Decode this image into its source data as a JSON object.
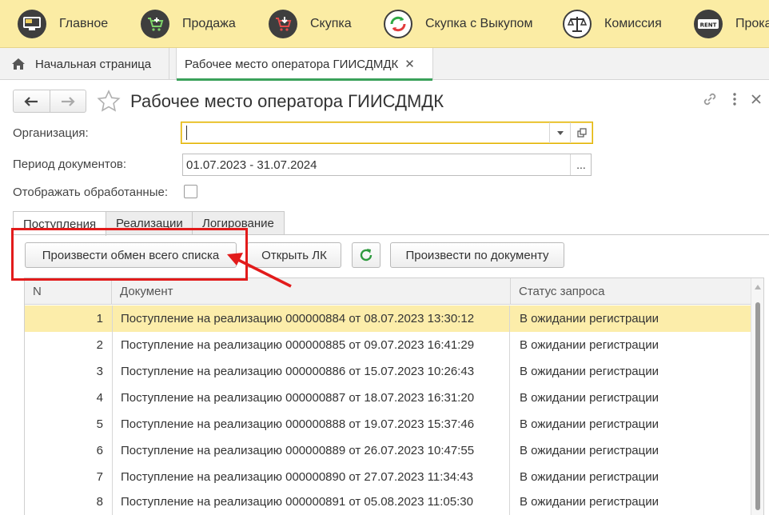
{
  "topnav": {
    "items": [
      {
        "label": "Главное",
        "icon": "desktop-icon"
      },
      {
        "label": "Продажа",
        "icon": "cart-plus-icon"
      },
      {
        "label": "Скупка",
        "icon": "cart-down-icon"
      },
      {
        "label": "Скупка с Выкупом",
        "icon": "refresh-circle-icon"
      },
      {
        "label": "Комиссия",
        "icon": "scales-icon"
      },
      {
        "label": "Прока",
        "icon": "rent-icon"
      }
    ]
  },
  "tabs": {
    "home_label": "Начальная страница",
    "active_label": "Рабочее место оператора ГИИСДМДК",
    "close_symbol": "✕"
  },
  "header": {
    "title": "Рабочее место оператора ГИИСДМДК"
  },
  "form": {
    "org_label": "Организация:",
    "org_value": "",
    "period_label": "Период документов:",
    "period_value": "01.07.2023 - 31.07.2024",
    "period_btn": "...",
    "show_processed_label": "Отображать обработанные:",
    "show_processed_checked": false
  },
  "inner_tabs": [
    "Поступления",
    "Реализации",
    "Логирование"
  ],
  "buttons": {
    "exchange_all": "Произвести обмен всего списка",
    "open_lk": "Открыть ЛК",
    "by_document": "Произвести по документу"
  },
  "table": {
    "columns": [
      "N",
      "Документ",
      "Статус запроса"
    ],
    "rows": [
      {
        "n": "1",
        "doc": "Поступление на реализацию 000000884 от 08.07.2023 13:30:12",
        "status": "В ожидании регистрации"
      },
      {
        "n": "2",
        "doc": "Поступление на реализацию 000000885 от 09.07.2023 16:41:29",
        "status": "В ожидании регистрации"
      },
      {
        "n": "3",
        "doc": "Поступление на реализацию 000000886 от 15.07.2023 10:26:43",
        "status": "В ожидании регистрации"
      },
      {
        "n": "4",
        "doc": "Поступление на реализацию 000000887 от 18.07.2023 16:31:20",
        "status": "В ожидании регистрации"
      },
      {
        "n": "5",
        "doc": "Поступление на реализацию 000000888 от 19.07.2023 15:37:46",
        "status": "В ожидании регистрации"
      },
      {
        "n": "6",
        "doc": "Поступление на реализацию 000000889 от 26.07.2023 10:47:55",
        "status": "В ожидании регистрации"
      },
      {
        "n": "7",
        "doc": "Поступление на реализацию 000000890 от 27.07.2023 11:34:43",
        "status": "В ожидании регистрации"
      },
      {
        "n": "8",
        "doc": "Поступление на реализацию 000000891 от 05.08.2023 11:05:30",
        "status": "В ожидании регистрации"
      }
    ]
  },
  "colors": {
    "nav_bg": "#fbeca4",
    "selected_row": "#fcedaa",
    "annotation_red": "#e21b1b",
    "active_tab_accent": "#3aa15a"
  }
}
